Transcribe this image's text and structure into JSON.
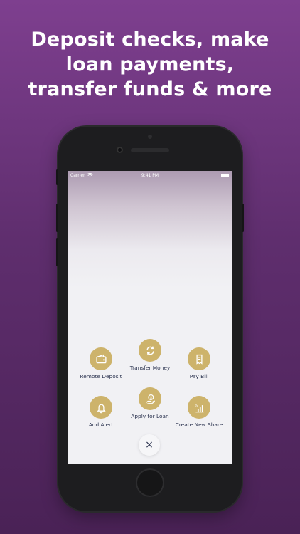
{
  "headline": {
    "line1": "Deposit checks, make",
    "line2": "loan payments,",
    "line3": "transfer funds & more"
  },
  "status_bar": {
    "carrier": "Carrier",
    "time": "9:41 PM"
  },
  "actions": [
    {
      "label": "Remote Deposit",
      "icon": "wallet-icon"
    },
    {
      "label": "Transfer Money",
      "icon": "transfer-arrows-icon"
    },
    {
      "label": "Pay Bill",
      "icon": "bill-icon"
    },
    {
      "label": "Add Alert",
      "icon": "bell-icon"
    },
    {
      "label": "Apply for Loan",
      "icon": "loan-hand-icon"
    },
    {
      "label": "Create New Share",
      "icon": "share-chart-icon"
    }
  ],
  "close": {
    "label": "×",
    "icon": "close-icon"
  },
  "colors": {
    "background_top": "#7e3f8f",
    "background_bottom": "#4a2256",
    "accent_gold": "#cdb36b",
    "label_text": "#2c3450"
  }
}
